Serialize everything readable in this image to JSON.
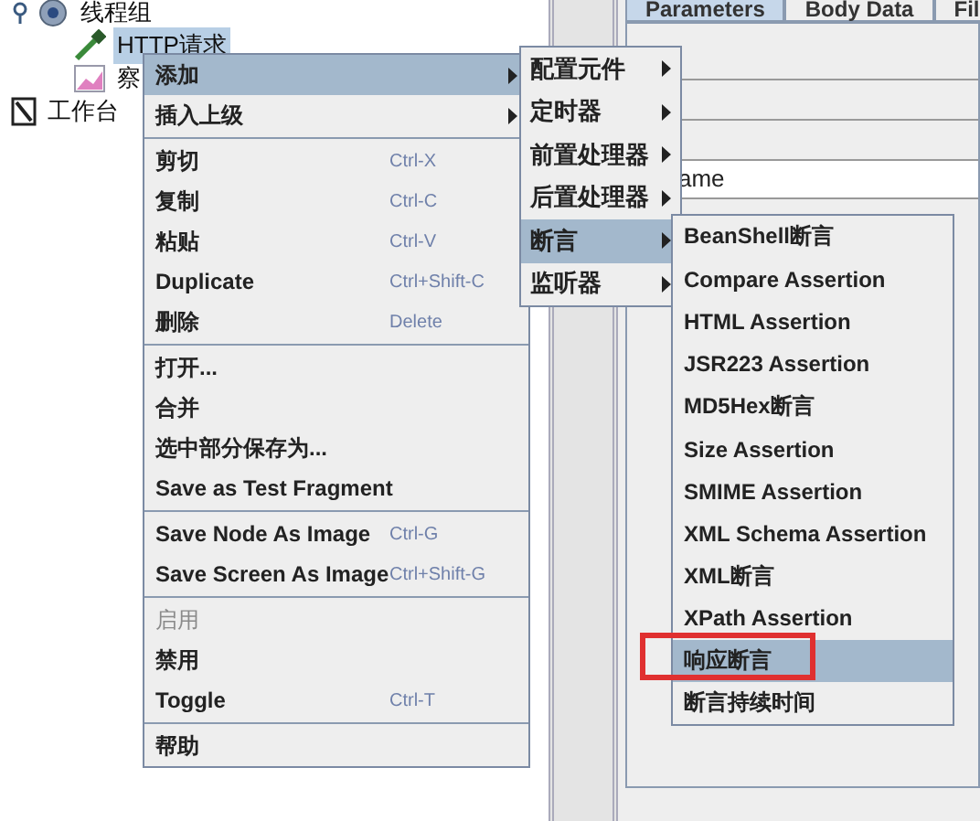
{
  "tree": [
    {
      "label": "线程组",
      "kind": "group",
      "selected": false,
      "children": [
        {
          "label": "HTTP请求",
          "kind": "sampler",
          "selected": true
        },
        {
          "label": "察",
          "kind": "listener",
          "selected": false
        }
      ]
    },
    {
      "label": "工作台",
      "kind": "workbench",
      "selected": false
    }
  ],
  "panel": {
    "tabs": [
      {
        "label": "Parameters",
        "selected": true
      },
      {
        "label": "Body Data",
        "selected": false
      },
      {
        "label": "Fil",
        "selected": false
      }
    ],
    "field": {
      "value": "ame"
    }
  },
  "menu": [
    {
      "kind": "submenu",
      "label": "添加",
      "selected": true,
      "disabled": false
    },
    {
      "kind": "submenu",
      "label": "插入上级",
      "selected": false,
      "disabled": false
    },
    {
      "kind": "separator"
    },
    {
      "kind": "item",
      "label": "剪切",
      "shortcut": "Ctrl-X",
      "selected": false,
      "disabled": false
    },
    {
      "kind": "item",
      "label": "复制",
      "shortcut": "Ctrl-C",
      "selected": false,
      "disabled": false
    },
    {
      "kind": "item",
      "label": "粘贴",
      "shortcut": "Ctrl-V",
      "selected": false,
      "disabled": false
    },
    {
      "kind": "item",
      "label": "Duplicate",
      "shortcut": "Ctrl+Shift-C",
      "selected": false,
      "disabled": false
    },
    {
      "kind": "item",
      "label": "删除",
      "shortcut": "Delete",
      "selected": false,
      "disabled": false
    },
    {
      "kind": "separator"
    },
    {
      "kind": "item",
      "label": "打开...",
      "selected": false,
      "disabled": false
    },
    {
      "kind": "item",
      "label": "合并",
      "selected": false,
      "disabled": false
    },
    {
      "kind": "item",
      "label": "选中部分保存为...",
      "selected": false,
      "disabled": false
    },
    {
      "kind": "item",
      "label": "Save as Test Fragment",
      "selected": false,
      "disabled": false
    },
    {
      "kind": "separator"
    },
    {
      "kind": "item",
      "label": "Save Node As Image",
      "shortcut": "Ctrl-G",
      "selected": false,
      "disabled": false
    },
    {
      "kind": "item",
      "label": "Save Screen As Image",
      "shortcut": "Ctrl+Shift-G",
      "selected": false,
      "disabled": false
    },
    {
      "kind": "separator"
    },
    {
      "kind": "item",
      "label": "启用",
      "selected": false,
      "disabled": true
    },
    {
      "kind": "item",
      "label": "禁用",
      "selected": false,
      "disabled": false
    },
    {
      "kind": "item",
      "label": "Toggle",
      "shortcut": "Ctrl-T",
      "selected": false,
      "disabled": false
    },
    {
      "kind": "separator"
    },
    {
      "kind": "item",
      "label": "帮助",
      "selected": false,
      "disabled": false
    }
  ],
  "add_menu": [
    {
      "label": "配置元件",
      "selected": false
    },
    {
      "label": "定时器",
      "selected": false
    },
    {
      "label": "前置处理器",
      "selected": false
    },
    {
      "label": "后置处理器",
      "selected": false
    },
    {
      "label": "断言",
      "selected": true
    },
    {
      "label": "监听器",
      "selected": false
    }
  ],
  "assertion_menu": [
    {
      "label": "BeanShell断言",
      "selected": false,
      "marked": false
    },
    {
      "label": "Compare Assertion",
      "selected": false,
      "marked": false
    },
    {
      "label": "HTML Assertion",
      "selected": false,
      "marked": false
    },
    {
      "label": "JSR223 Assertion",
      "selected": false,
      "marked": false
    },
    {
      "label": "MD5Hex断言",
      "selected": false,
      "marked": false
    },
    {
      "label": "Size Assertion",
      "selected": false,
      "marked": false
    },
    {
      "label": "SMIME Assertion",
      "selected": false,
      "marked": false
    },
    {
      "label": "XML Schema Assertion",
      "selected": false,
      "marked": false
    },
    {
      "label": "XML断言",
      "selected": false,
      "marked": false
    },
    {
      "label": "XPath Assertion",
      "selected": false,
      "marked": false
    },
    {
      "label": "响应断言",
      "selected": true,
      "marked": true
    },
    {
      "label": "断言持续时间",
      "selected": false,
      "marked": false
    }
  ]
}
